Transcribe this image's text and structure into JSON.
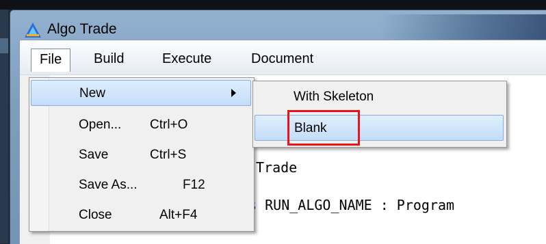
{
  "window": {
    "title": "Algo Trade",
    "accent": "#5b7fa6"
  },
  "menubar": {
    "items": [
      "File",
      "Build",
      "Execute",
      "Document"
    ]
  },
  "file_menu": {
    "items": [
      {
        "label": "New",
        "shortcut": "",
        "submenu": true,
        "highlighted": true
      },
      {
        "label": "Open...",
        "shortcut": "Ctrl+O"
      },
      {
        "label": "Save",
        "shortcut": "Ctrl+S"
      },
      {
        "label": "Save As...",
        "shortcut": "F12"
      },
      {
        "label": "Close",
        "shortcut": "Alt+F4"
      }
    ]
  },
  "new_submenu": {
    "items": [
      {
        "label": "With Skeleton",
        "highlighted": false
      },
      {
        "label": "Blank",
        "highlighted": true
      }
    ]
  },
  "editor": {
    "line1": "Trade",
    "line2_keyword": "ss",
    "line2_rest": " RUN_ALGO_NAME : Program"
  },
  "annotation": {
    "color": "#e8141c",
    "target": "Blank"
  },
  "icons": {
    "app": "algo-trade-logo-icon",
    "submenu": "submenu-arrow-icon"
  }
}
